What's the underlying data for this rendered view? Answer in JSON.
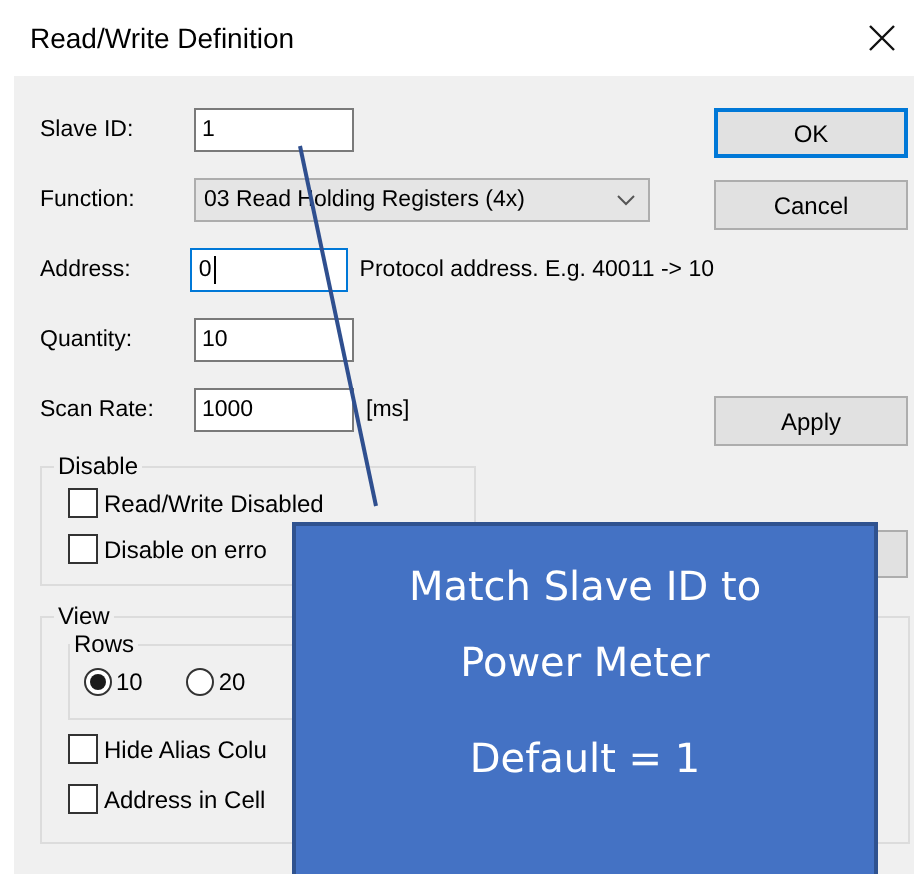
{
  "window": {
    "title": "Read/Write Definition"
  },
  "fields": [
    {
      "label": "Slave ID:",
      "kind": "text",
      "value": "1",
      "focused": false
    },
    {
      "label": "Function:",
      "kind": "dropdown",
      "value": "03 Read Holding Registers (4x)",
      "focused": false
    },
    {
      "label": "Address:",
      "kind": "text",
      "value": "0",
      "focused": true,
      "hint": "Protocol address. E.g. 40011 -> 10"
    },
    {
      "label": "Quantity:",
      "kind": "text",
      "value": "10",
      "focused": false
    },
    {
      "label": "Scan Rate:",
      "kind": "text",
      "value": "1000",
      "focused": false,
      "unit": "[ms]"
    }
  ],
  "buttons": [
    {
      "label": "OK",
      "default": true
    },
    {
      "label": "Cancel",
      "default": false
    },
    {
      "label": "Apply",
      "default": false
    }
  ],
  "disable_group": {
    "title": "Disable",
    "options": [
      {
        "label": "Read/Write Disabled",
        "checked": false
      },
      {
        "label": "Disable on erro",
        "checked": false
      }
    ]
  },
  "view_group": {
    "title": "View",
    "rows": {
      "title": "Rows",
      "options": [
        {
          "label": "10",
          "selected": true
        },
        {
          "label": "20",
          "selected": false
        }
      ]
    },
    "options": [
      {
        "label": "Hide Alias Colu",
        "checked": false
      },
      {
        "label": "Address in Cell",
        "checked": false
      }
    ]
  },
  "callout": {
    "lines": [
      "Match Slave ID to",
      "Power Meter",
      "Default = 1"
    ]
  }
}
